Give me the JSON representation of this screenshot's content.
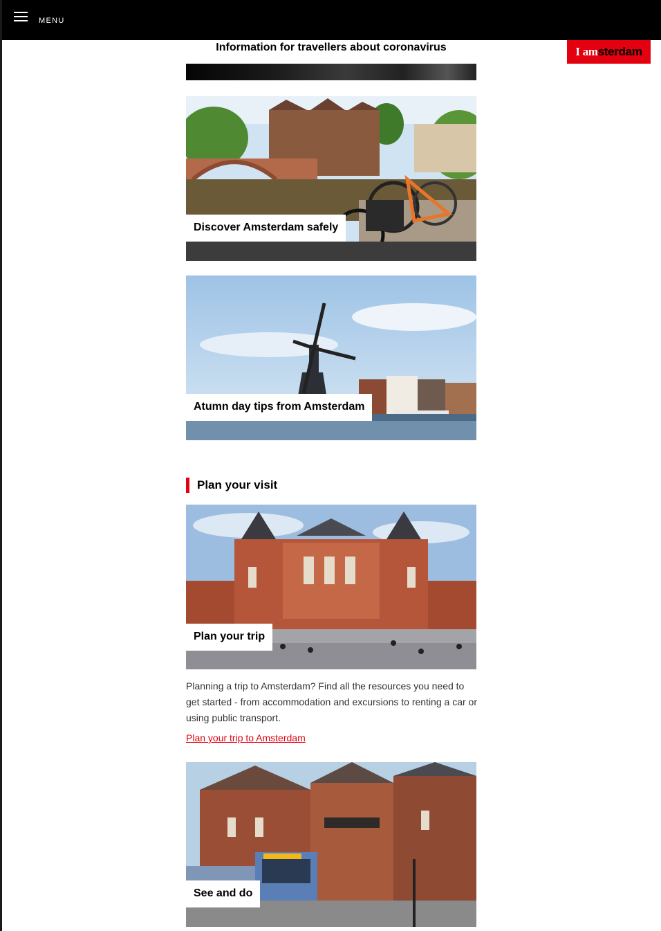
{
  "header": {
    "menu_label": "MENU"
  },
  "brand": {
    "logo_prefix": "I am",
    "logo_suffix": "sterdam"
  },
  "notice": {
    "text": "Information for travellers about coronavirus"
  },
  "cards_top": [
    {
      "label": "Discover Amsterdam safely"
    },
    {
      "label": "Atumn day tips from Amsterdam"
    }
  ],
  "plan_section": {
    "title": "Plan your visit",
    "cards": [
      {
        "label": "Plan your trip",
        "description": "Planning a trip to Amsterdam? Find all the resources you need to get started - from accommodation and excursions to renting a car or using public transport.",
        "link": "Plan your trip to Amsterdam"
      },
      {
        "label": "See and do"
      }
    ]
  },
  "colors": {
    "accent": "#e3000f",
    "topbar": "#000000",
    "link": "#e3000f"
  }
}
